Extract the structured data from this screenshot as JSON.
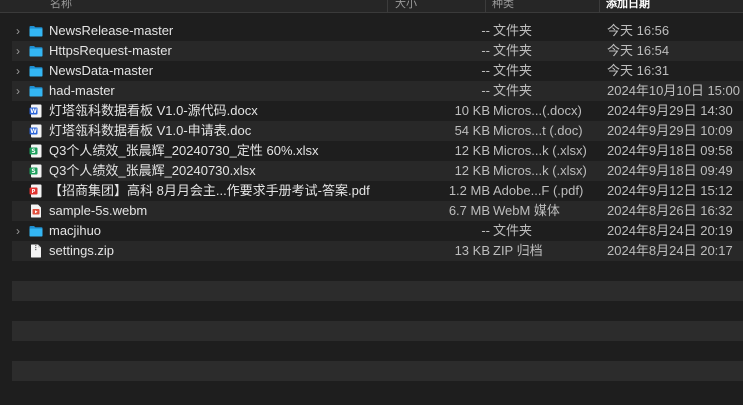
{
  "header": {
    "name": "名称",
    "size": "大小",
    "kind": "种类",
    "date": "添加日期"
  },
  "rows": [
    {
      "name": "NewsRelease-master",
      "size": "--",
      "kind": "文件夹",
      "date": "今天 16:56",
      "icon": "folder-icon",
      "expandable": true
    },
    {
      "name": "HttpsRequest-master",
      "size": "--",
      "kind": "文件夹",
      "date": "今天 16:54",
      "icon": "folder-icon",
      "expandable": true
    },
    {
      "name": "NewsData-master",
      "size": "--",
      "kind": "文件夹",
      "date": "今天 16:31",
      "icon": "folder-icon",
      "expandable": true
    },
    {
      "name": "had-master",
      "size": "--",
      "kind": "文件夹",
      "date": "2024年10月10日 15:00",
      "icon": "folder-icon",
      "expandable": true
    },
    {
      "name": "灯塔瓴科数据看板 V1.0-源代码.docx",
      "size": "10 KB",
      "kind": "Micros...(.docx)",
      "date": "2024年9月29日 14:30",
      "icon": "word-doc-icon",
      "expandable": false
    },
    {
      "name": "灯塔瓴科数据看板 V1.0-申请表.doc",
      "size": "54 KB",
      "kind": "Micros...t (.doc)",
      "date": "2024年9月29日 10:09",
      "icon": "word-doc-icon",
      "expandable": false
    },
    {
      "name": "Q3个人绩效_张晨辉_20240730_定性 60%.xlsx",
      "size": "12 KB",
      "kind": "Micros...k (.xlsx)",
      "date": "2024年9月18日 09:58",
      "icon": "excel-sheet-icon",
      "expandable": false
    },
    {
      "name": "Q3个人绩效_张晨辉_20240730.xlsx",
      "size": "12 KB",
      "kind": "Micros...k (.xlsx)",
      "date": "2024年9月18日 09:49",
      "icon": "excel-sheet-icon",
      "expandable": false
    },
    {
      "name": "【招商集团】高科 8月月会主...作要求手册考试-答案.pdf",
      "size": "1.2 MB",
      "kind": "Adobe...F (.pdf)",
      "date": "2024年9月12日 15:12",
      "icon": "pdf-icon",
      "expandable": false
    },
    {
      "name": "sample-5s.webm",
      "size": "6.7 MB",
      "kind": "WebM 媒体",
      "date": "2024年8月26日 16:32",
      "icon": "video-file-icon",
      "expandable": false
    },
    {
      "name": "macjihuo",
      "size": "--",
      "kind": "文件夹",
      "date": "2024年8月24日 20:19",
      "icon": "folder-icon",
      "expandable": true
    },
    {
      "name": "settings.zip",
      "size": "13 KB",
      "kind": "ZIP 归档",
      "date": "2024年8月24日 20:17",
      "icon": "zip-file-icon",
      "expandable": false
    }
  ],
  "colors": {
    "background": "#1e1e1e",
    "alt_row": "#282828",
    "folder": "#2fb3f2",
    "word": "#2b64d8",
    "excel": "#1d9f5c",
    "pdf": "#e0322f",
    "video": "#e0503e"
  }
}
